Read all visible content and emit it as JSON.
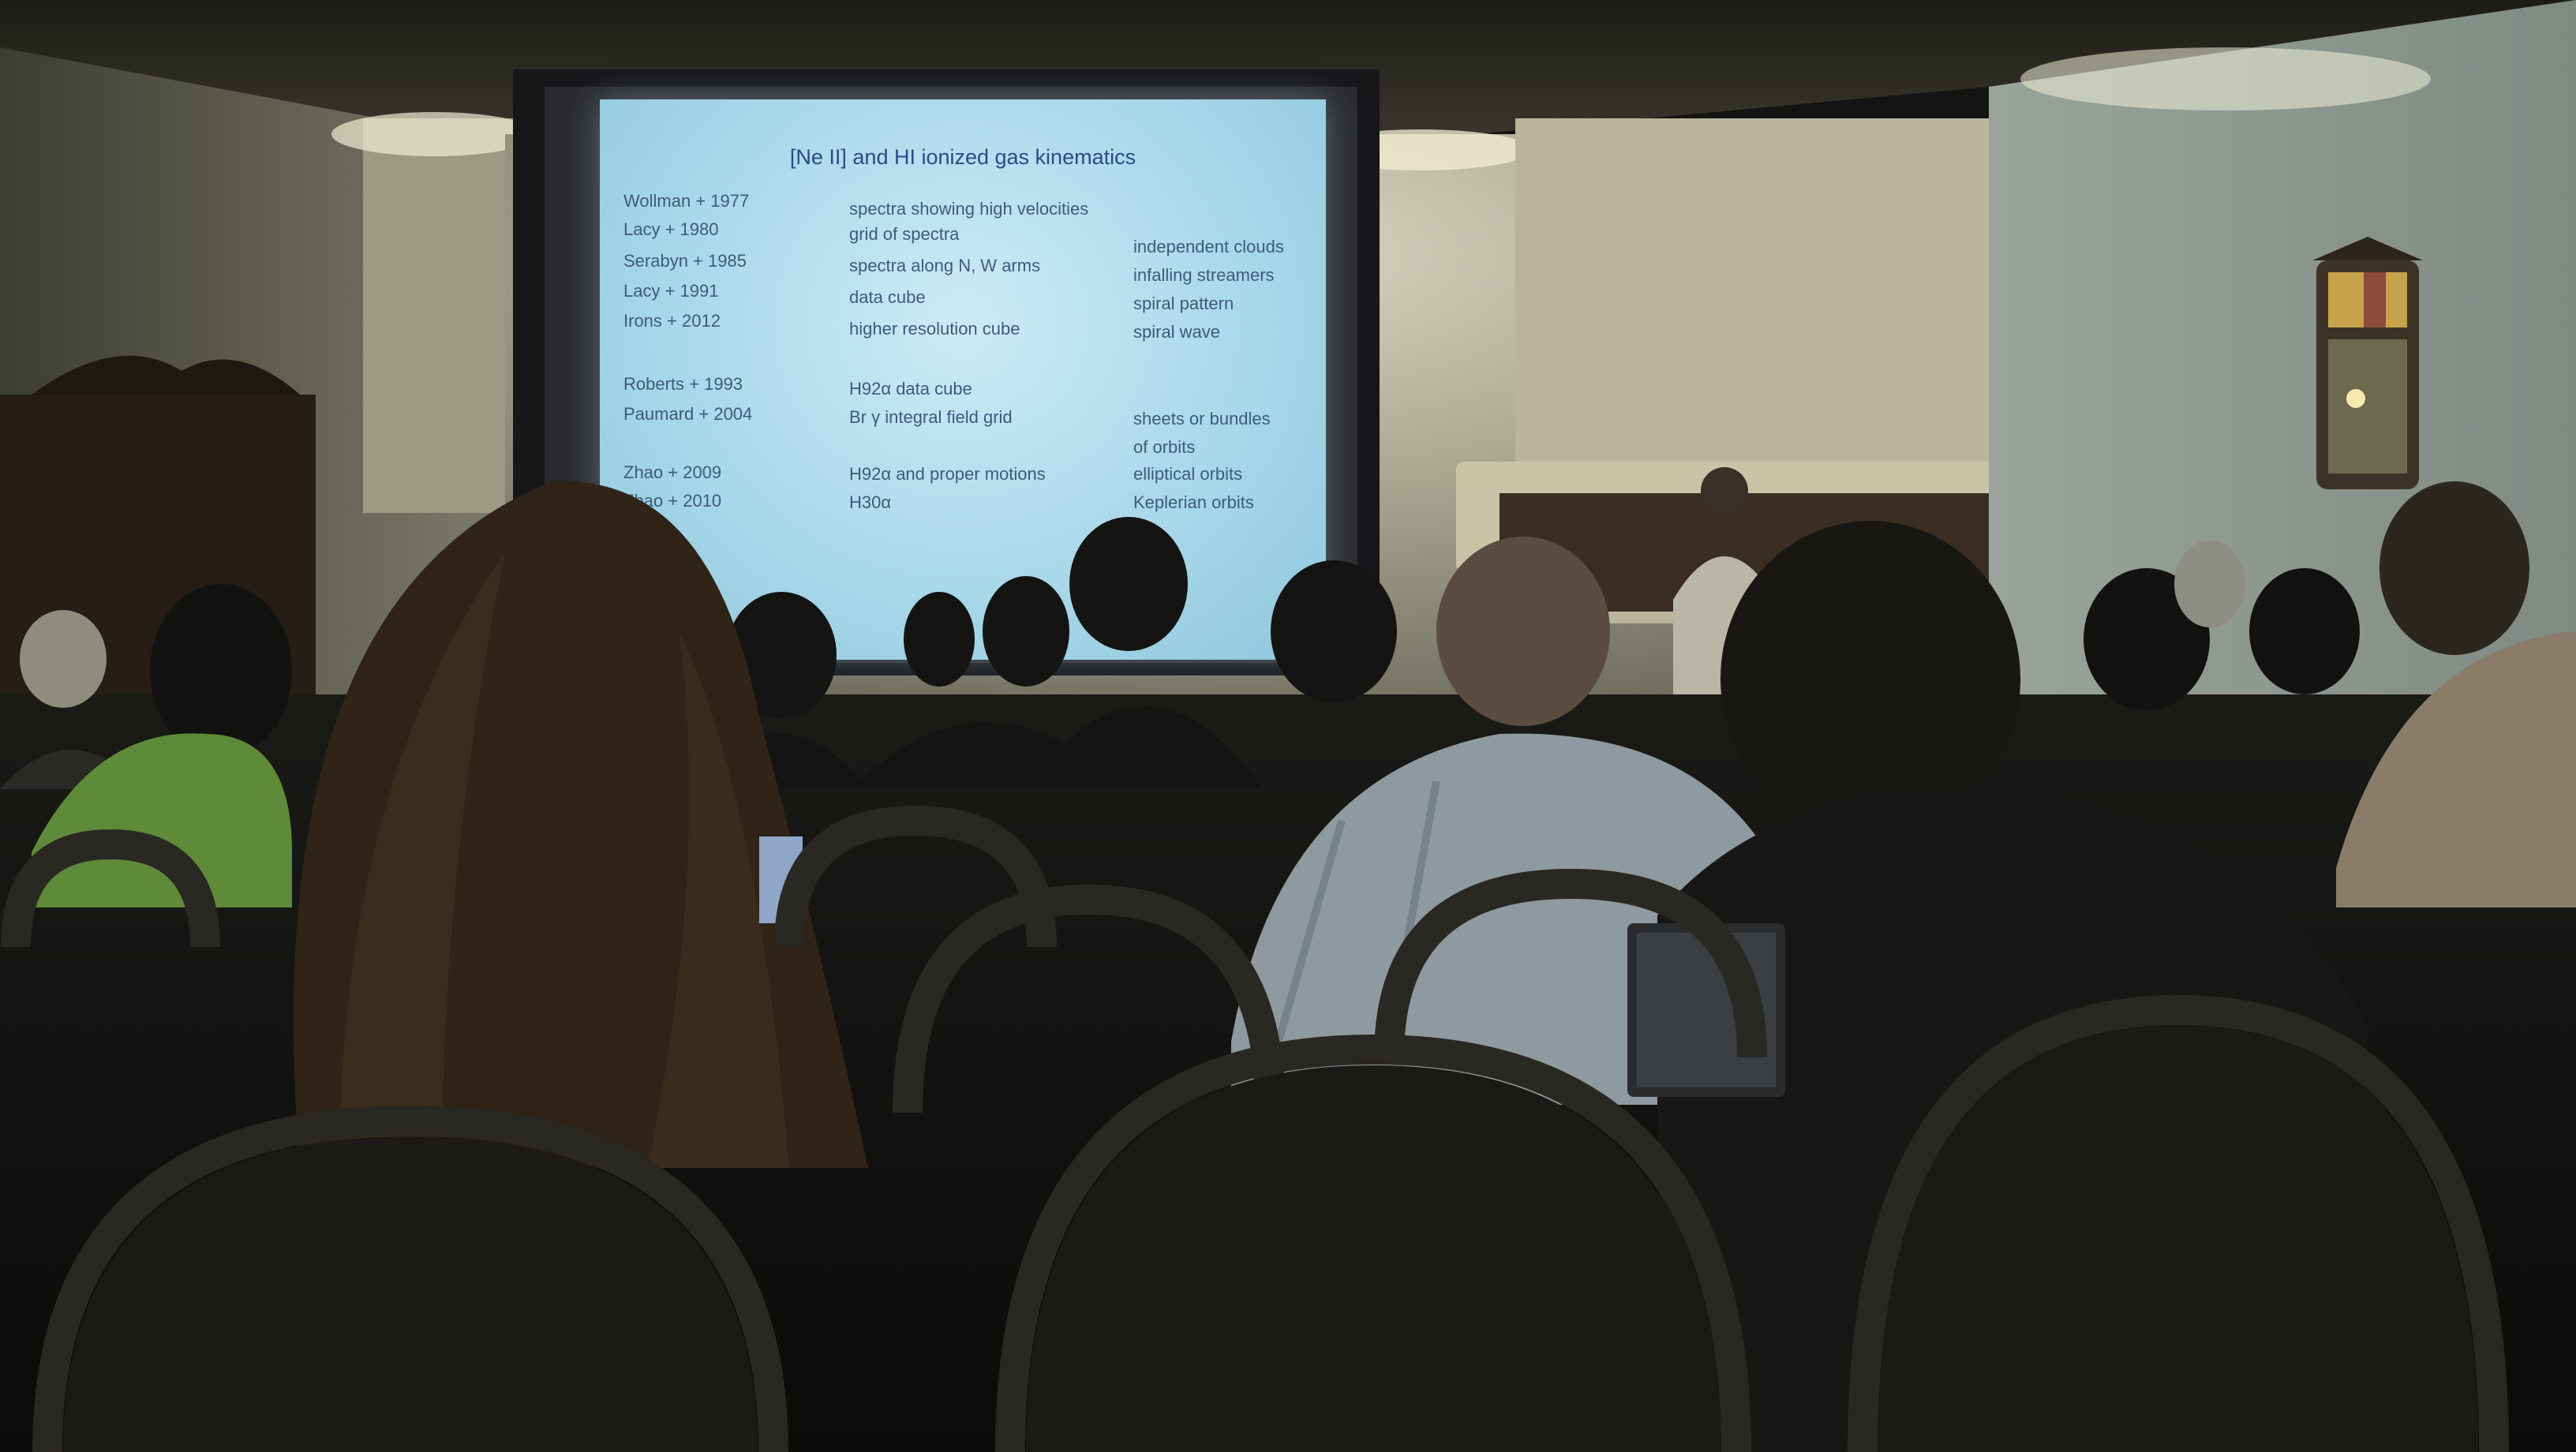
{
  "slide": {
    "title": "[Ne II] and HI ionized gas kinematics",
    "rows": [
      {
        "author": "Wollman + 1977",
        "method": "spectra showing high velocities",
        "result": ""
      },
      {
        "author": "Lacy + 1980",
        "method": "grid of spectra",
        "result": "independent clouds"
      },
      {
        "author": "Serabyn + 1985",
        "method": "spectra along N, W arms",
        "result": "infalling streamers"
      },
      {
        "author": "Lacy + 1991",
        "method": "data cube",
        "result": "spiral pattern"
      },
      {
        "author": "Irons + 2012",
        "method": "higher resolution cube",
        "result": "spiral wave"
      },
      {
        "author": "Roberts + 1993",
        "method": "H92α data cube",
        "result": ""
      },
      {
        "author": "Paumard + 2004",
        "method": "Br γ integral field grid",
        "result": "sheets or bundles"
      },
      {
        "author": "",
        "method": "",
        "result": "of orbits"
      },
      {
        "author": "Zhao + 2009",
        "method": "H92α and proper motions",
        "result": "elliptical orbits"
      },
      {
        "author": "Zhao + 2010",
        "method": "H30α",
        "result": "Keplerian orbits"
      }
    ]
  },
  "colors": {
    "slide_text": "#3e5a7e",
    "slide_title": "#2b4a86",
    "wall": "#a9a793",
    "ceiling": "#2a2a22",
    "audience": "#0f100e"
  }
}
